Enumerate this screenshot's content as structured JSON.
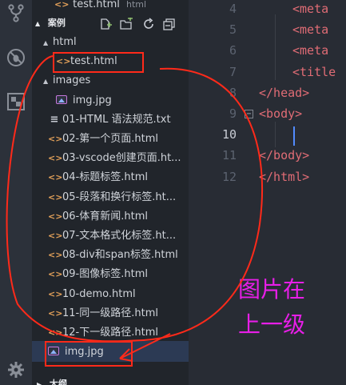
{
  "explorer": {
    "open_file": {
      "name": "test.html",
      "folder": "html"
    },
    "section_title": "案例",
    "tree": [
      {
        "type": "folder",
        "label": "html",
        "depth": 1
      },
      {
        "type": "html",
        "label": "test.html",
        "depth": 2
      },
      {
        "type": "folder",
        "label": "images",
        "depth": 1
      },
      {
        "type": "image",
        "label": "img.jpg",
        "depth": 2
      },
      {
        "type": "txt",
        "label": "01-HTML 语法规范.txt",
        "depth": 1
      },
      {
        "type": "html",
        "label": "02-第一个页面.html",
        "depth": 1
      },
      {
        "type": "html",
        "label": "03-vscode创建页面.ht...",
        "depth": 1
      },
      {
        "type": "html",
        "label": "04-标题标签.html",
        "depth": 1
      },
      {
        "type": "html",
        "label": "05-段落和换行标签.ht...",
        "depth": 1
      },
      {
        "type": "html",
        "label": "06-体育新闻.html",
        "depth": 1
      },
      {
        "type": "html",
        "label": "07-文本格式化标签.ht...",
        "depth": 1
      },
      {
        "type": "html",
        "label": "08-div和span标签.html",
        "depth": 1
      },
      {
        "type": "html",
        "label": "09-图像标签.html",
        "depth": 1
      },
      {
        "type": "html",
        "label": "10-demo.html",
        "depth": 1
      },
      {
        "type": "html",
        "label": "11-同一级路径.html",
        "depth": 1
      },
      {
        "type": "html",
        "label": "12-下一级路径.html",
        "depth": 1
      },
      {
        "type": "image",
        "label": "img.jpg",
        "depth": 1
      }
    ],
    "bottom_section": "大纲"
  },
  "editor": {
    "lines": [
      {
        "n": "4",
        "code": "<meta"
      },
      {
        "n": "5",
        "code": "<meta"
      },
      {
        "n": "6",
        "code": "<meta"
      },
      {
        "n": "7",
        "code": "<title"
      },
      {
        "n": "8",
        "code": "</head>"
      },
      {
        "n": "9",
        "code": "<body>"
      },
      {
        "n": "10",
        "code": ""
      },
      {
        "n": "11",
        "code": "</body>"
      },
      {
        "n": "12",
        "code": "</html>"
      }
    ]
  },
  "annotation": {
    "line1": "图片在",
    "line2": "上一级"
  },
  "colors": {
    "annotation": "#e81ee8",
    "highlight": "#ff2a1a",
    "tag": "#e06c75"
  }
}
